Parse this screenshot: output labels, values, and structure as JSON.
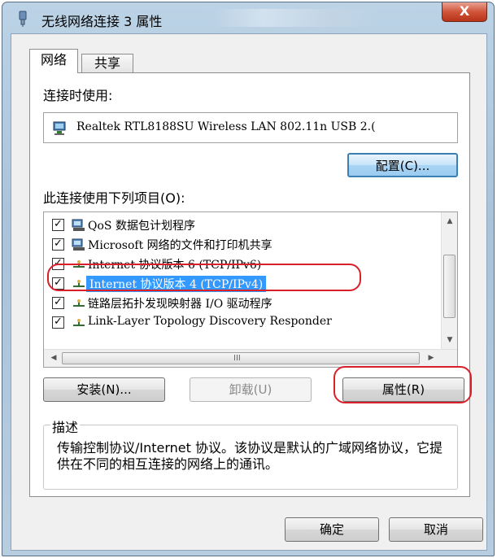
{
  "window": {
    "title": "无线网络连接 3 属性",
    "close_label": "X"
  },
  "tabs": [
    {
      "label": "网络"
    },
    {
      "label": "共享"
    }
  ],
  "connect_using_label": "连接时使用:",
  "adapter": {
    "name": "Realtek RTL8188SU Wireless LAN 802.11n USB 2.(",
    "icon": "network-adapter-icon"
  },
  "configure_button": "配置(C)...",
  "items_label": "此连接使用下列项目(O):",
  "items": [
    {
      "label": "QoS 数据包计划程序",
      "checked": true,
      "icon": "qos-icon"
    },
    {
      "label": "Microsoft 网络的文件和打印机共享",
      "checked": true,
      "icon": "file-printer-share-icon"
    },
    {
      "label": "Internet 协议版本 6 (TCP/IPv6)",
      "checked": true,
      "icon": "protocol-icon"
    },
    {
      "label": "Internet 协议版本 4 (TCP/IPv4)",
      "checked": true,
      "icon": "protocol-icon",
      "selected": true
    },
    {
      "label": "链路层拓扑发现映射器 I/O 驱动程序",
      "checked": true,
      "icon": "protocol-icon"
    },
    {
      "label": "Link-Layer Topology Discovery Responder",
      "checked": true,
      "icon": "protocol-icon"
    }
  ],
  "scrollbar": {
    "grip": "III"
  },
  "buttons": {
    "install": "安装(N)...",
    "uninstall": "卸载(U)",
    "properties": "属性(R)",
    "ok": "确定",
    "cancel": "取消"
  },
  "description": {
    "title": "描述",
    "text": "传输控制协议/Internet 协议。该协议是默认的广域网络协议，它提供在不同的相互连接的网络上的通讯。"
  },
  "colors": {
    "highlight": "#3399ff",
    "annotation_red": "#d9202a",
    "default_button_border": "#3c7fb1"
  }
}
